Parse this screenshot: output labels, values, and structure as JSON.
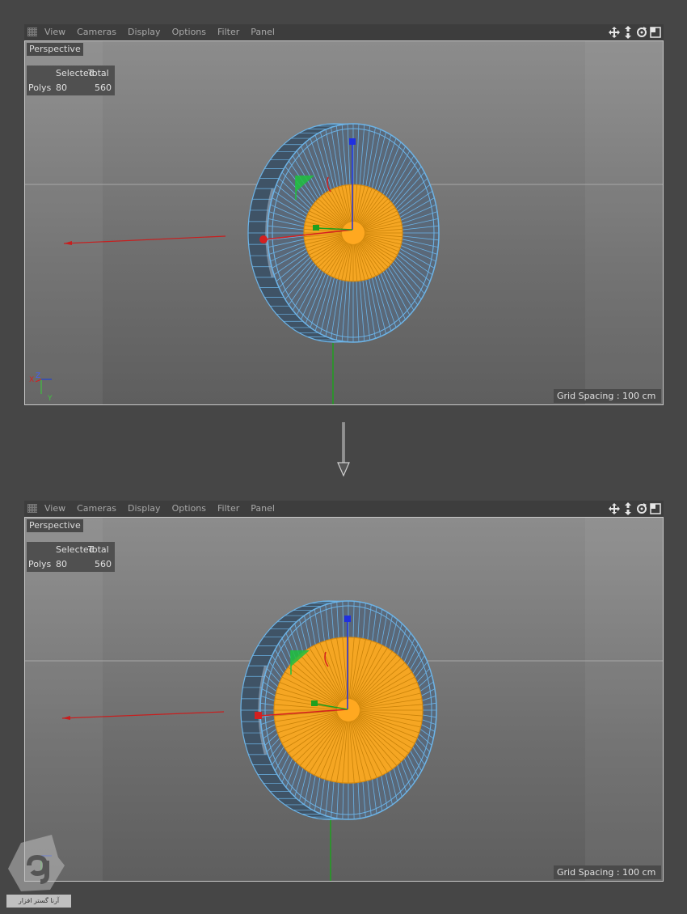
{
  "menu": [
    "View",
    "Cameras",
    "Display",
    "Options",
    "Filter",
    "Panel"
  ],
  "nav_icons": [
    "move-view-icon",
    "dolly-view-icon",
    "rotate-view-icon",
    "layout-toggle-icon"
  ],
  "viewports": [
    {
      "camera_label": "Perspective",
      "stats": {
        "headers": [
          "Selected",
          "Total"
        ],
        "row_label": "Polys",
        "selected": "80",
        "total": "560"
      },
      "grid_spacing": "Grid Spacing : 100 cm",
      "selected_region": "inner-disc"
    },
    {
      "camera_label": "Perspective",
      "stats": {
        "headers": [
          "Selected",
          "Total"
        ],
        "row_label": "Polys",
        "selected": "80",
        "total": "560"
      },
      "grid_spacing": "Grid Spacing : 100 cm",
      "selected_region": "enlarged-inner-disc"
    }
  ],
  "axis_labels": {
    "x": "X",
    "y": "Y",
    "z": "Z"
  },
  "watermark": {
    "caption": "آرنا گستر افزار"
  },
  "colors": {
    "background": "#464646",
    "wireframe": "#6cb4e8",
    "selection": "#f5a623",
    "axis_x": "#d42020",
    "axis_y": "#20c040",
    "axis_z": "#2030e0"
  }
}
